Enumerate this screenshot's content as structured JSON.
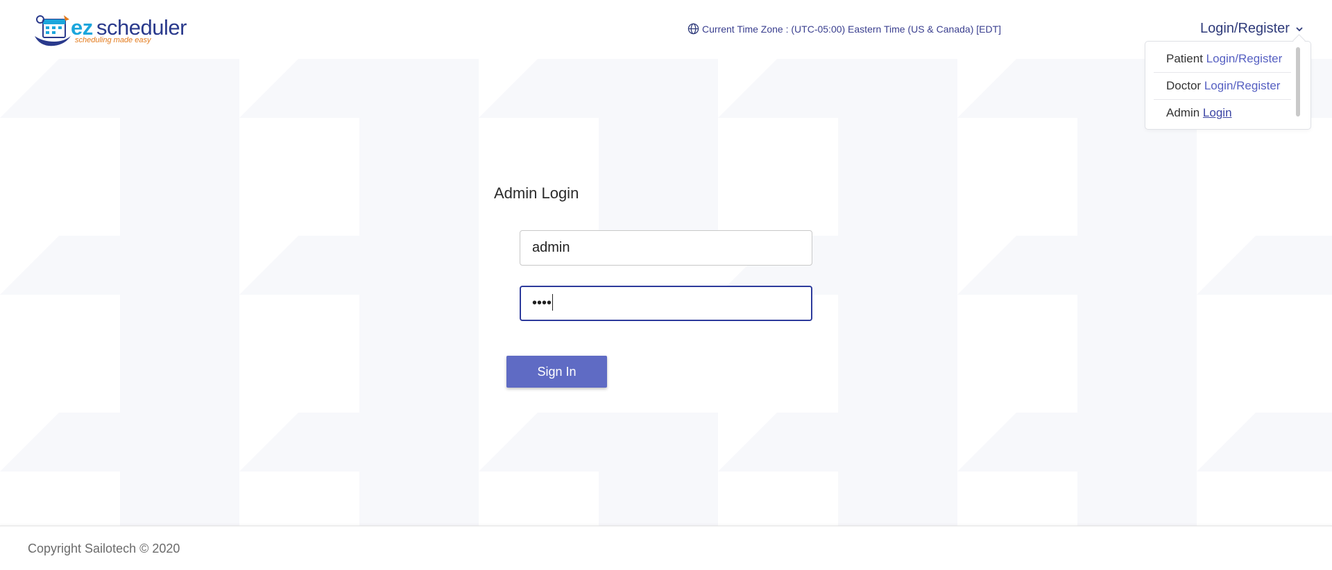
{
  "header": {
    "logo": {
      "ez": "ez",
      "scheduler": "scheduler",
      "tagline": "scheduling made easy"
    },
    "timezone_text": "Current Time Zone : (UTC-05:00) Eastern Time (US & Canada) [EDT]",
    "login_toggle": "Login/Register"
  },
  "dropdown": {
    "items": [
      {
        "prefix": "Patient",
        "link": "Login/Register"
      },
      {
        "prefix": "Doctor",
        "link": "Login/Register"
      },
      {
        "prefix": "Admin",
        "link": "Login"
      }
    ]
  },
  "form": {
    "title": "Admin Login",
    "username_value": "admin",
    "password_value": "••••",
    "signin_label": "Sign In"
  },
  "footer": {
    "copyright": "Copyright Sailotech © 2020"
  },
  "colors": {
    "accent": "#5f6bc4",
    "link": "#5660c2",
    "focus_border": "#2d3b9c",
    "brand_blue": "#1ba6dc",
    "brand_navy": "#2a3a8c",
    "brand_orange": "#e37a1b"
  },
  "icons": {
    "timezone": "globe-icon",
    "toggle": "chevron-down-icon",
    "logo": "calendar-hand-logo"
  }
}
